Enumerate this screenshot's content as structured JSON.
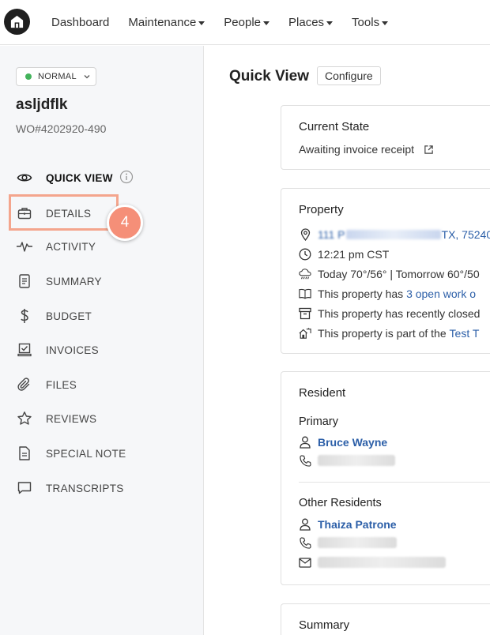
{
  "nav": {
    "items": [
      {
        "label": "Dashboard",
        "dropdown": false
      },
      {
        "label": "Maintenance",
        "dropdown": true
      },
      {
        "label": "People",
        "dropdown": true
      },
      {
        "label": "Places",
        "dropdown": true
      },
      {
        "label": "Tools",
        "dropdown": true
      }
    ]
  },
  "sidebar": {
    "status": "NORMAL",
    "status_color": "#43b35b",
    "title": "asljdflk",
    "wo_number": "WO#4202920-490",
    "items": [
      {
        "label": "QUICK VIEW",
        "icon": "eye-icon"
      },
      {
        "label": "DETAILS",
        "icon": "briefcase-icon"
      },
      {
        "label": "ACTIVITY",
        "icon": "activity-icon"
      },
      {
        "label": "SUMMARY",
        "icon": "document-icon"
      },
      {
        "label": "BUDGET",
        "icon": "dollar-icon"
      },
      {
        "label": "INVOICES",
        "icon": "invoice-icon"
      },
      {
        "label": "FILES",
        "icon": "paperclip-icon"
      },
      {
        "label": "REVIEWS",
        "icon": "star-icon"
      },
      {
        "label": "SPECIAL NOTE",
        "icon": "note-icon"
      },
      {
        "label": "TRANSCRIPTS",
        "icon": "chat-icon"
      }
    ]
  },
  "tutorial": {
    "step": "4",
    "highlight_color": "#f4a58d",
    "badge_color": "#f58f78"
  },
  "main": {
    "title": "Quick View",
    "configure_label": "Configure",
    "current_state": {
      "title": "Current State",
      "value": "Awaiting invoice receipt"
    },
    "property": {
      "title": "Property",
      "address_visible": "111 P",
      "address_end": "TX, 75240",
      "time": "12:21 pm CST",
      "weather": "Today 70°/56° | Tomorrow 60°/50",
      "work_orders_prefix": "This property has ",
      "work_orders_link": "3 open work o",
      "recently_closed": "This property has recently closed",
      "part_of_prefix": "This property is part of the ",
      "part_of_link": "Test T"
    },
    "resident": {
      "title": "Resident",
      "primary_label": "Primary",
      "primary_name": "Bruce Wayne",
      "other_label": "Other Residents",
      "other_name": "Thaiza Patrone"
    },
    "summary": {
      "title": "Summary"
    }
  },
  "colors": {
    "link": "#2c5fa8",
    "sidebar_bg": "#f6f7f9"
  }
}
